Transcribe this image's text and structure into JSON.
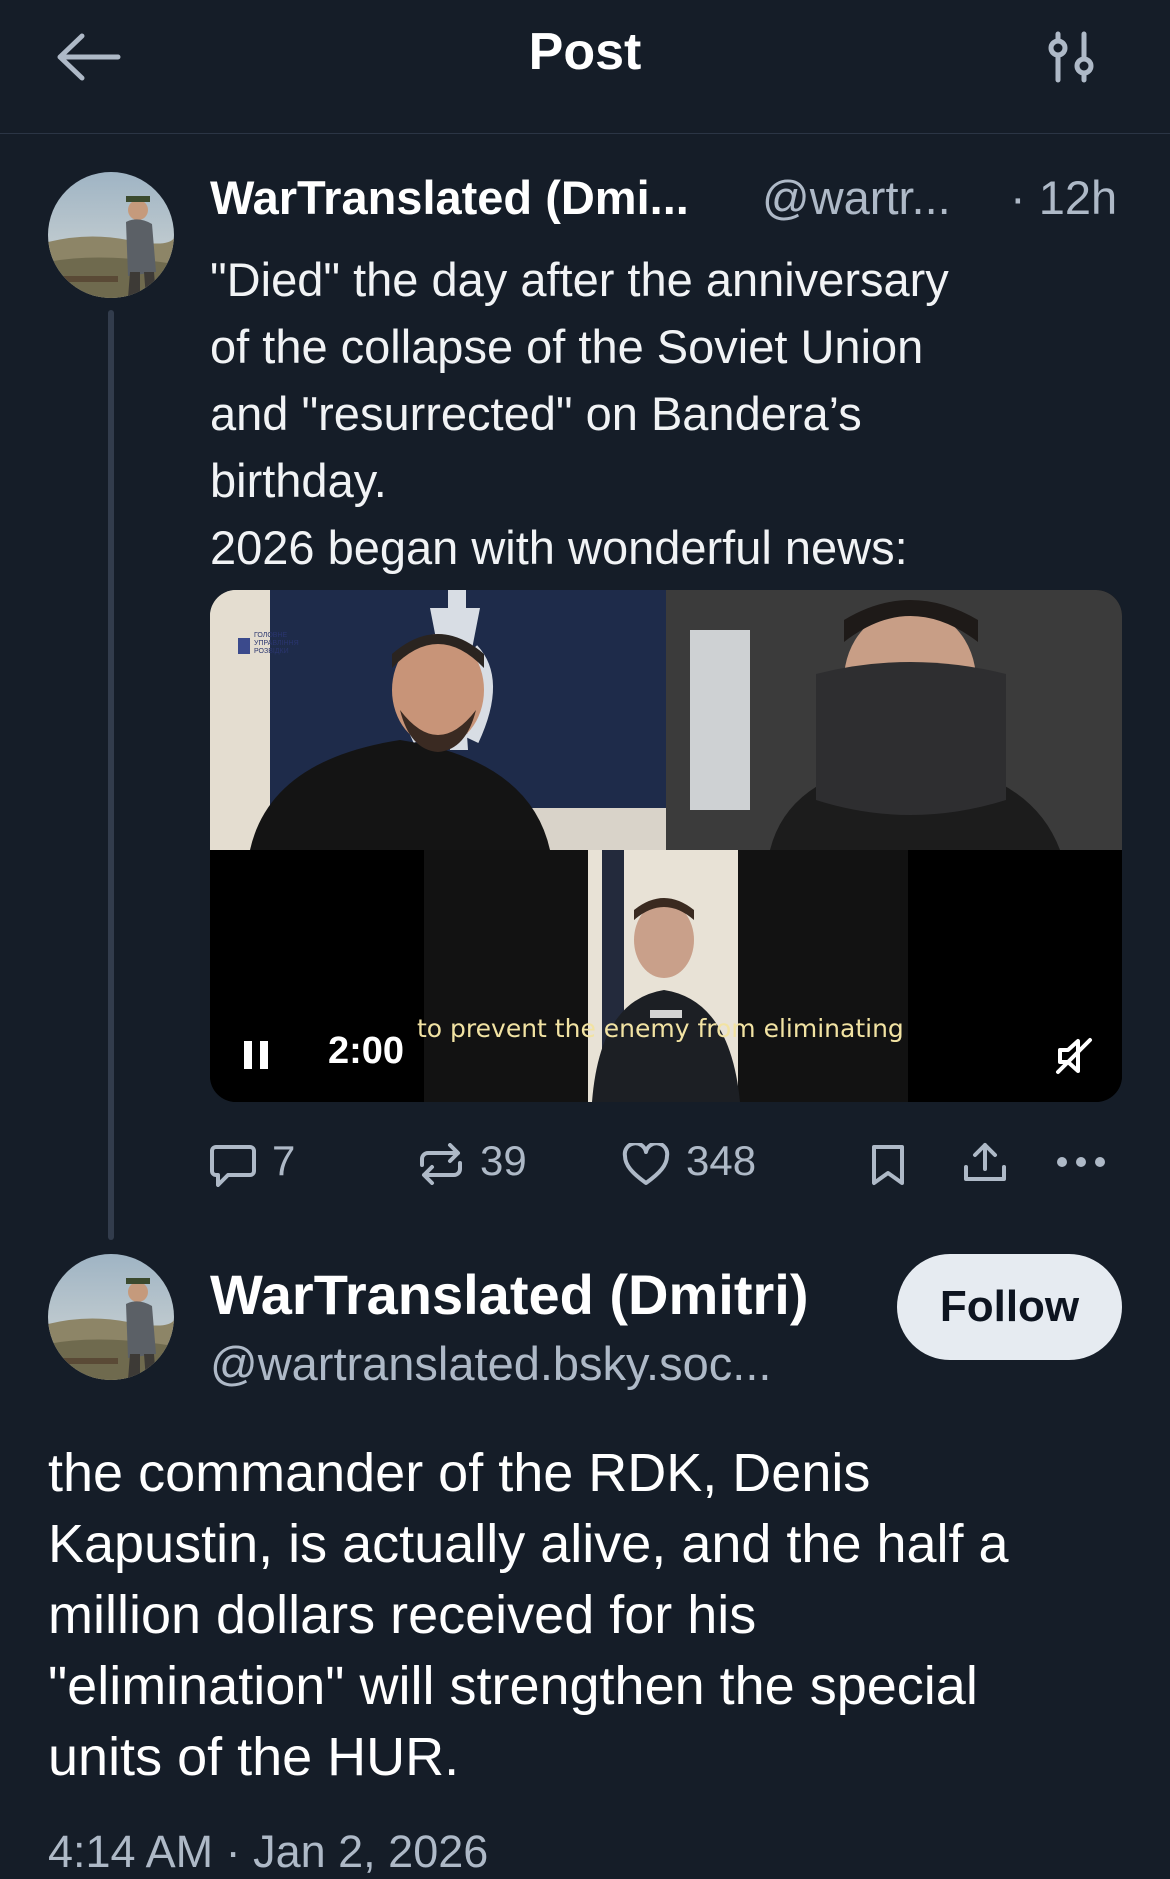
{
  "header": {
    "title": "Post",
    "back_icon": "arrow-left-icon",
    "filter_icon": "sliders-icon"
  },
  "parent_post": {
    "author_name": "WarTranslated (Dmi...",
    "handle": "@wartr...",
    "time": "· 12h",
    "text_lines": [
      "\"Died\" the day after the anniversary",
      "of the collapse of the Soviet Union",
      "and \"resurrected\" on Bandera’s",
      "birthday.",
      "2026 began with wonderful news:"
    ],
    "video": {
      "subtitle": "to prevent the enemy from eliminating",
      "time": "2:00",
      "overlay_text": "ГОЛОВНЕ УПРАВЛІННЯ РОЗВІДКИ"
    },
    "actions": {
      "replies": "7",
      "reposts": "39",
      "likes": "348"
    }
  },
  "main_post": {
    "author_name": "WarTranslated (Dmitri)",
    "handle": "@wartranslated.bsky.soc...",
    "follow_label": "Follow",
    "text_lines": [
      "the commander of the RDK, Denis",
      "Kapustin, is actually alive, and the half a",
      "million dollars received for his",
      "\"elimination\" will strengthen the special",
      "units of the HUR."
    ],
    "date": "4:14 AM · Jan 2, 2026"
  },
  "colors": {
    "background": "#151d28",
    "muted_text": "#aeb9c7",
    "follow_button": "#e6ebf1"
  }
}
